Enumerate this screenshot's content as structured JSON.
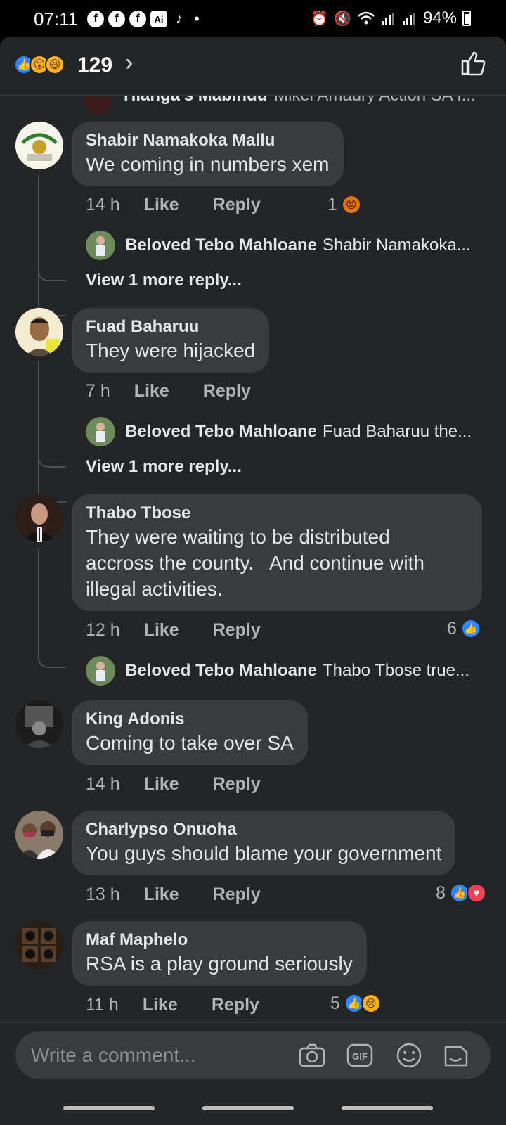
{
  "status_bar": {
    "time": "07:11",
    "app_icons": [
      "f",
      "f",
      "f",
      "Ai"
    ],
    "tiktok": "♪",
    "dot": "•",
    "battery": "94%"
  },
  "reaction_bar": {
    "count": "129",
    "chevron": "›"
  },
  "partial_comment": {
    "name": "Hlanga's Mabindu",
    "text": "Mikel Amaury Action SA I..."
  },
  "comments": [
    {
      "name": "Shabir Namakoka Mallu",
      "text": "We coming in numbers xem",
      "time": "14 h",
      "like": "Like",
      "reply": "Reply",
      "reaction_count": "1",
      "reply_preview": {
        "name": "Beloved Tebo Mahloane",
        "text": "Shabir Namakoka..."
      },
      "view_more": "View 1 more reply..."
    },
    {
      "name": "Fuad Baharuu",
      "text": "They were hijacked",
      "time": "7 h",
      "like": "Like",
      "reply": "Reply",
      "reply_preview": {
        "name": "Beloved Tebo Mahloane",
        "text": "Fuad Baharuu the..."
      },
      "view_more": "View 1 more reply..."
    },
    {
      "name": "Thabo Tbose",
      "text": "They were waiting to be distributed\naccross the county.   And continue with\nillegal activities.",
      "time": "12 h",
      "like": "Like",
      "reply": "Reply",
      "reaction_count": "6",
      "reply_preview": {
        "name": "Beloved Tebo Mahloane",
        "text": "Thabo Tbose true..."
      }
    },
    {
      "name": "King Adonis",
      "text": "Coming to take over SA",
      "time": "14 h",
      "like": "Like",
      "reply": "Reply"
    },
    {
      "name": "Charlypso Onuoha",
      "text": "You guys should blame your government",
      "time": "13 h",
      "like": "Like",
      "reply": "Reply",
      "reaction_count": "8"
    },
    {
      "name": "Maf Maphelo",
      "text": "RSA is a play ground seriously",
      "time": "11 h",
      "like": "Like",
      "reply": "Reply",
      "reaction_count": "5"
    }
  ],
  "compose": {
    "placeholder": "Write a comment...",
    "gif_label": "GIF"
  },
  "colors": {
    "background": "#242526",
    "bubble": "#3a3b3c",
    "like_blue": "#2d88ff",
    "love_red": "#f33e58"
  }
}
